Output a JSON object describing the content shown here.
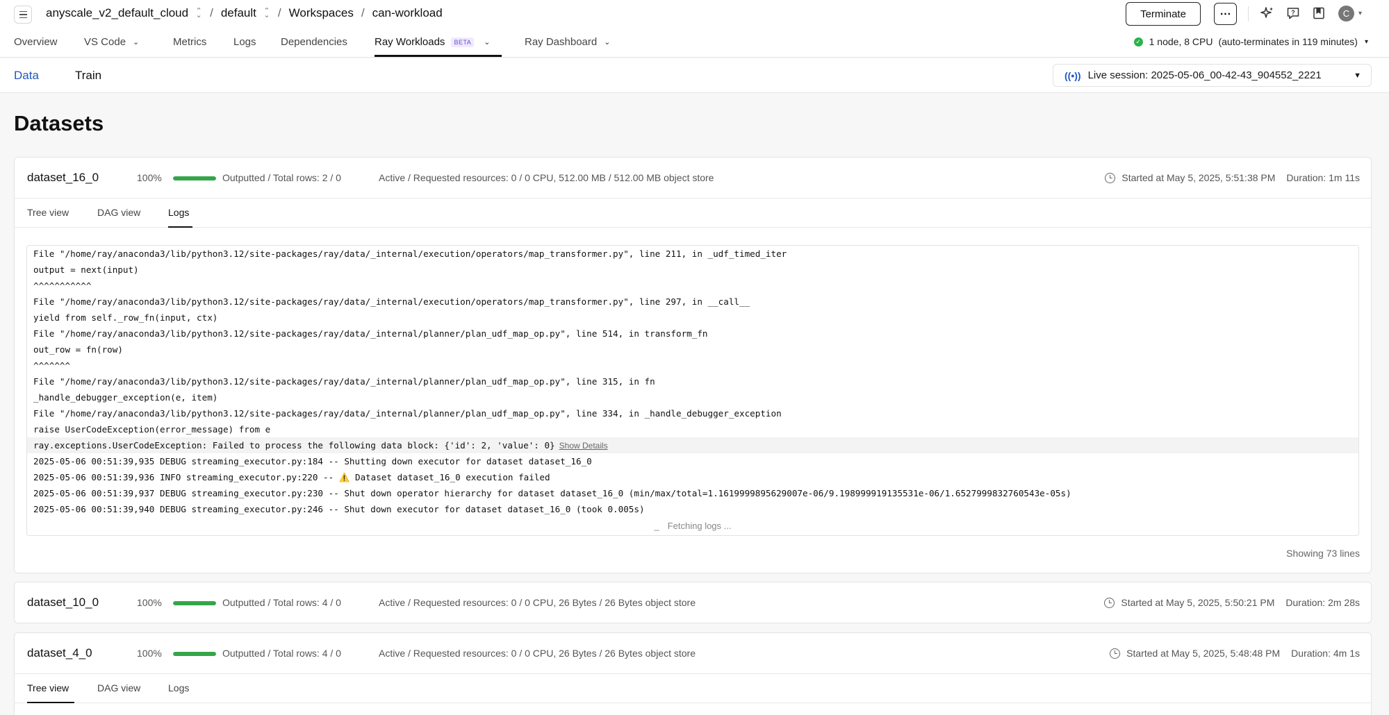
{
  "header": {
    "breadcrumbs": [
      "anyscale_v2_default_cloud",
      "default",
      "Workspaces",
      "can-workload"
    ],
    "breadcrumb_sep": "/",
    "terminate_label": "Terminate",
    "more_label": "⋯",
    "avatar_initial": "C"
  },
  "nav": {
    "tabs": [
      {
        "label": "Overview"
      },
      {
        "label": "VS Code"
      },
      {
        "label": "Metrics"
      },
      {
        "label": "Logs"
      },
      {
        "label": "Dependencies"
      },
      {
        "label": "Ray Workloads",
        "badge": "BETA"
      },
      {
        "label": "Ray Dashboard"
      }
    ],
    "active_tab": "Ray Workloads",
    "cluster_status": "1 node, 8 CPU",
    "cluster_terminate": "(auto-terminates in 119 minutes)",
    "status_color": "#2bb24c"
  },
  "subnav": {
    "tabs": [
      "Data",
      "Train"
    ],
    "active": "Data",
    "live_session": "Live session: 2025-05-06_00-42-43_904552_2221",
    "accent_color": "#1f57c3"
  },
  "page_title": "Datasets",
  "datasets": [
    {
      "name": "dataset_16_0",
      "progress_pct": "100%",
      "progress": 1.0,
      "rows": "Outputted / Total rows: 2 / 0",
      "resources": "Active / Requested resources: 0 / 0 CPU, 512.00 MB / 512.00 MB object store",
      "started": "Started at May 5, 2025, 5:51:38 PM",
      "duration": "Duration: 1m 11s",
      "tabs": [
        "Tree view",
        "DAG view",
        "Logs"
      ],
      "active_tab": "Logs",
      "logs": [
        "File \"/home/ray/anaconda3/lib/python3.12/site-packages/ray/data/_internal/execution/operators/map_transformer.py\", line 211, in _udf_timed_iter",
        "output = next(input)",
        "^^^^^^^^^^^",
        "File \"/home/ray/anaconda3/lib/python3.12/site-packages/ray/data/_internal/execution/operators/map_transformer.py\", line 297, in __call__",
        "yield from self._row_fn(input, ctx)",
        "File \"/home/ray/anaconda3/lib/python3.12/site-packages/ray/data/_internal/planner/plan_udf_map_op.py\", line 514, in transform_fn",
        "out_row = fn(row)",
        "^^^^^^^",
        "File \"/home/ray/anaconda3/lib/python3.12/site-packages/ray/data/_internal/planner/plan_udf_map_op.py\", line 315, in fn",
        "_handle_debugger_exception(e, item)",
        "File \"/home/ray/anaconda3/lib/python3.12/site-packages/ray/data/_internal/planner/plan_udf_map_op.py\", line 334, in _handle_debugger_exception",
        "raise UserCodeException(error_message) from e",
        "ray.exceptions.UserCodeException: Failed to process the following data block: {'id': 2, 'value': 0}",
        "2025-05-06 00:51:39,935 DEBUG streaming_executor.py:184 -- Shutting down executor for dataset dataset_16_0",
        "2025-05-06 00:51:39,936 INFO streaming_executor.py:220 -- ⚠️ Dataset dataset_16_0 execution failed",
        "2025-05-06 00:51:39,937 DEBUG streaming_executor.py:230 -- Shut down operator hierarchy for dataset dataset_16_0 (min/max/total=1.1619999895629007e-06/9.198999919135531e-06/1.6527999832760543e-05s)",
        "2025-05-06 00:51:39,940 DEBUG streaming_executor.py:246 -- Shut down executor for dataset dataset_16_0 (took 0.005s)"
      ],
      "show_details_label": "Show Details",
      "fetching_label": "Fetching logs ...",
      "fetching_glyph": "_",
      "showing_lines": "Showing 73 lines"
    },
    {
      "name": "dataset_10_0",
      "progress_pct": "100%",
      "progress": 1.0,
      "rows": "Outputted / Total rows: 4 / 0",
      "resources": "Active / Requested resources: 0 / 0 CPU, 26 Bytes / 26 Bytes object store",
      "started": "Started at May 5, 2025, 5:50:21 PM",
      "duration": "Duration: 2m 28s"
    },
    {
      "name": "dataset_4_0",
      "progress_pct": "100%",
      "progress": 1.0,
      "rows": "Outputted / Total rows: 4 / 0",
      "resources": "Active / Requested resources: 0 / 0 CPU, 26 Bytes / 26 Bytes object store",
      "started": "Started at May 5, 2025, 5:48:48 PM",
      "duration": "Duration: 4m 1s",
      "tabs": [
        "Tree view",
        "DAG view",
        "Logs"
      ],
      "active_tab": "Tree view"
    }
  ]
}
